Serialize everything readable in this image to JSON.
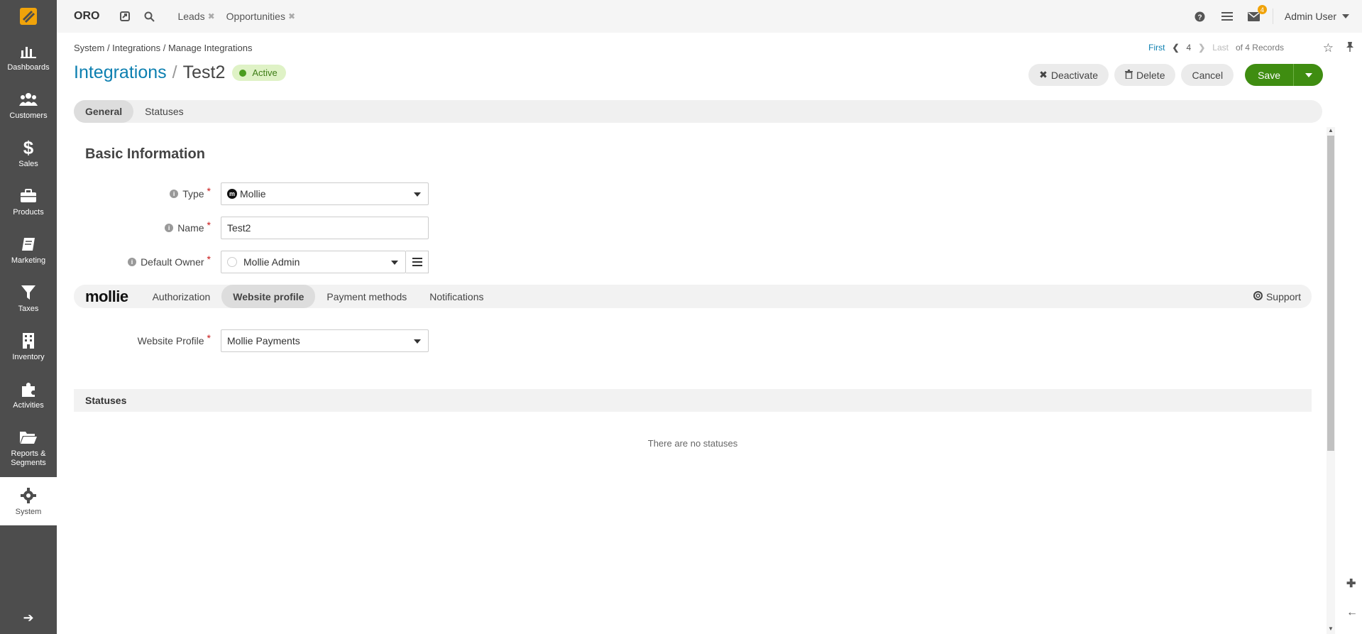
{
  "sidebar": {
    "items": [
      {
        "label": "Dashboards",
        "icon": "dashboards-icon"
      },
      {
        "label": "Customers",
        "icon": "customers-icon"
      },
      {
        "label": "Sales",
        "icon": "dollar-icon"
      },
      {
        "label": "Products",
        "icon": "briefcase-icon"
      },
      {
        "label": "Marketing",
        "icon": "book-icon"
      },
      {
        "label": "Taxes",
        "icon": "filter-icon"
      },
      {
        "label": "Inventory",
        "icon": "building-icon"
      },
      {
        "label": "Activities",
        "icon": "puzzle-icon"
      },
      {
        "label": "Reports & Segments",
        "icon": "folder-icon"
      },
      {
        "label": "System",
        "icon": "gear-icon"
      }
    ]
  },
  "topbar": {
    "brand": "ORO",
    "links": [
      "Leads",
      "Opportunities"
    ],
    "notification_count": "4",
    "user": "Admin User"
  },
  "breadcrumb": "System / Integrations / Manage Integrations",
  "pager": {
    "first": "First",
    "current": "4",
    "last": "Last",
    "total": "of 4 Records"
  },
  "title": {
    "section": "Integrations",
    "record": "Test2",
    "status": "Active"
  },
  "actions": {
    "deactivate": "Deactivate",
    "delete": "Delete",
    "cancel": "Cancel",
    "save": "Save"
  },
  "tabs": [
    "General",
    "Statuses"
  ],
  "basic_info": {
    "title": "Basic Information",
    "type_label": "Type",
    "type_value": "Mollie",
    "name_label": "Name",
    "name_value": "Test2",
    "owner_label": "Default Owner",
    "owner_value": "Mollie Admin"
  },
  "mollie": {
    "logo": "mollie",
    "tabs": [
      "Authorization",
      "Website profile",
      "Payment methods",
      "Notifications"
    ],
    "support": "Support",
    "website_profile_label": "Website Profile",
    "website_profile_value": "Mollie Payments"
  },
  "statuses": {
    "title": "Statuses",
    "empty": "There are no statuses"
  },
  "colors": {
    "accent": "#0c7fb0",
    "save": "#3f8d11",
    "sidebar": "#4d4d4d",
    "status_bg": "#dff2c6"
  }
}
